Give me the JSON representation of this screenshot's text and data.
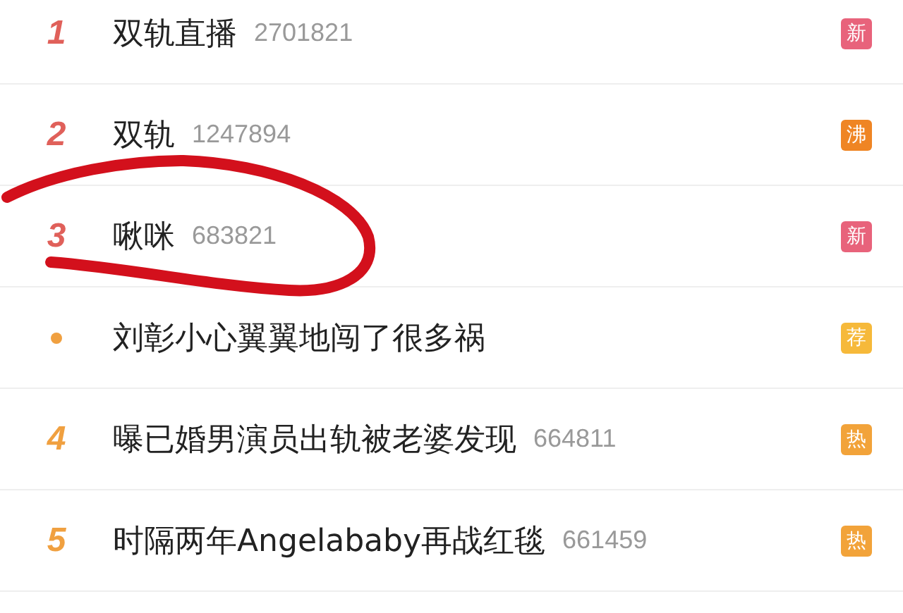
{
  "hot_search": [
    {
      "rank": {
        "kind": "number",
        "text": "1",
        "color": "#e0605a"
      },
      "title": "双轨直播",
      "count": "2701821",
      "badge": {
        "text": "新",
        "color": "#e8637b"
      }
    },
    {
      "rank": {
        "kind": "number",
        "text": "2",
        "color": "#e0605a"
      },
      "title": "双轨",
      "count": "1247894",
      "badge": {
        "text": "沸",
        "color": "#ef8524"
      }
    },
    {
      "rank": {
        "kind": "number",
        "text": "3",
        "color": "#e0605a"
      },
      "title": "啾咪",
      "count": "683821",
      "badge": {
        "text": "新",
        "color": "#e8637b"
      }
    },
    {
      "rank": {
        "kind": "dot",
        "color": "#f0a040"
      },
      "title": "刘彰小心翼翼地闯了很多祸",
      "badge": {
        "text": "荐",
        "color": "#f6b93a"
      }
    },
    {
      "rank": {
        "kind": "number",
        "text": "4",
        "color": "#f0a040"
      },
      "title": "曝已婚男演员出轨被老婆发现",
      "count": "664811",
      "badge": {
        "text": "热",
        "color": "#f2a33a"
      }
    },
    {
      "rank": {
        "kind": "number",
        "text": "5",
        "color": "#f0a040"
      },
      "title": "时隔两年Angelababy再战红毯",
      "count": "661459",
      "badge": {
        "text": "热",
        "color": "#f2a33a"
      }
    }
  ],
  "annotation": {
    "kind": "circle",
    "color": "#d3101c"
  }
}
